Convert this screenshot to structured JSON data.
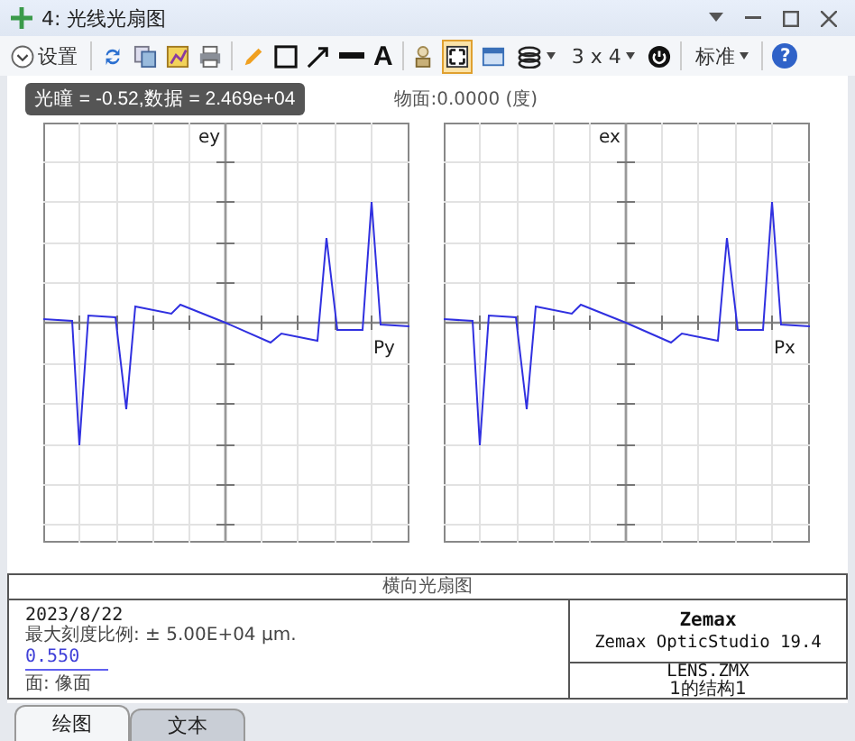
{
  "window": {
    "title": "4: 光线光扇图"
  },
  "toolbar": {
    "settings_label": "设置",
    "text_tool": "A",
    "fit_active": true,
    "layout_label": "3 x 4",
    "standard_label": "标准",
    "help": "?"
  },
  "tooltip": "光瞳 = -0.52,数据 = 2.469e+04",
  "field_label": "物面:0.0000 (度)",
  "plots": [
    {
      "y_label": "ey",
      "x_label": "Py"
    },
    {
      "y_label": "ex",
      "x_label": "Px"
    }
  ],
  "footer": {
    "title": "横向光扇图",
    "date": "2023/8/22",
    "scale": "最大刻度比例: ± 5.00E+04 μm.",
    "wavelength": "0.550",
    "surface": "面: 像面",
    "company": "Zemax",
    "product": "Zemax OpticStudio 19.4",
    "file": "LENS.ZMX",
    "config": "1的结构1"
  },
  "tabs": [
    {
      "label": "绘图",
      "selected": true
    },
    {
      "label": "文本",
      "selected": false
    }
  ]
}
